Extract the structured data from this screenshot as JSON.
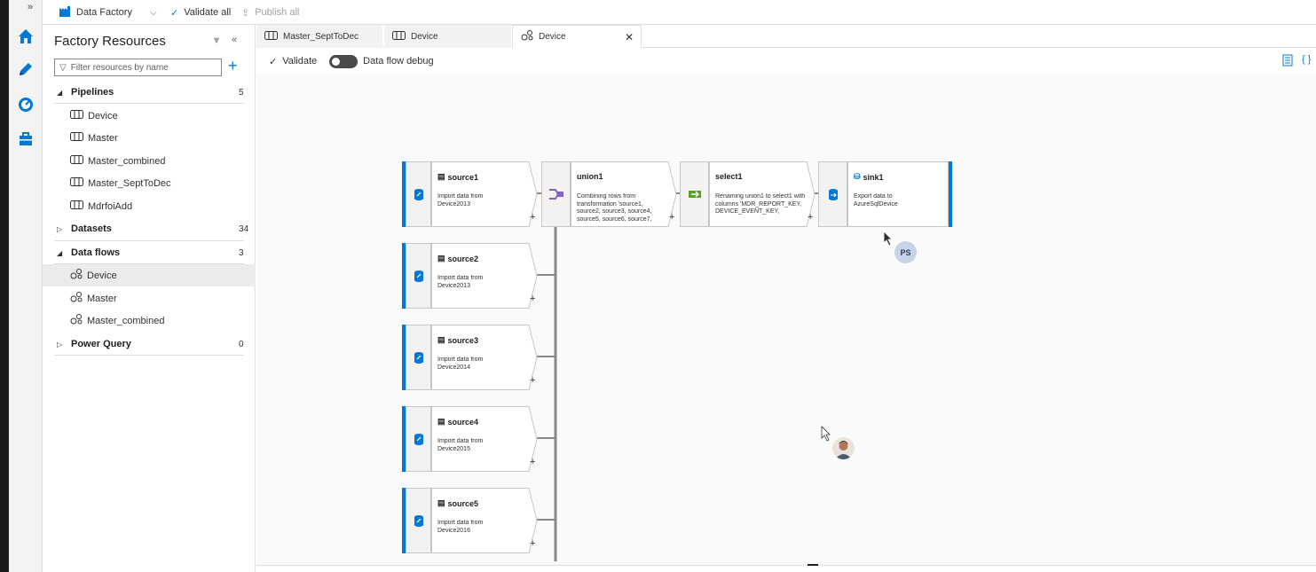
{
  "topbar": {
    "factory_label": "Data Factory",
    "validate_all_label": "Validate all",
    "publish_all_label": "Publish all"
  },
  "panel": {
    "title": "Factory Resources",
    "filter_placeholder": "Filter resources by name",
    "categories": [
      {
        "label": "Pipelines",
        "count": "5",
        "expanded": true,
        "items": [
          "Device",
          "Master",
          "Master_combined",
          "Master_SeptToDec",
          "MdrfoiAdd"
        ]
      },
      {
        "label": "Datasets",
        "count": "34",
        "expanded": false
      },
      {
        "label": "Data flows",
        "count": "3",
        "expanded": true,
        "items": [
          "Device",
          "Master",
          "Master_combined"
        ]
      },
      {
        "label": "Power Query",
        "count": "0",
        "expanded": false
      }
    ]
  },
  "tabs": [
    {
      "label": "Master_SeptToDec",
      "icon": "pipeline-icon"
    },
    {
      "label": "Device",
      "icon": "pipeline-icon"
    },
    {
      "label": "Device",
      "icon": "dataflow-icon",
      "active": true
    }
  ],
  "toolbar": {
    "validate_label": "Validate",
    "debug_label": "Data flow debug",
    "debug_on": false
  },
  "flow": {
    "source1": {
      "title": "source1",
      "desc": "Import data from Device2013"
    },
    "union1": {
      "title": "union1",
      "desc": "Combining rows from transformation 'source1, source2, source3, source4, source5, source6, source7,"
    },
    "select1": {
      "title": "select1",
      "desc": "Renaming union1 to select1 with columns 'MDR_REPORT_KEY, DEVICE_EVENT_KEY,"
    },
    "sink1": {
      "title": "sink1",
      "desc": "Export data to AzureSqlDevice"
    },
    "source2": {
      "title": "source2",
      "desc": "Import data from Device2013"
    },
    "source3": {
      "title": "source3",
      "desc": "Import data from Device2014"
    },
    "source4": {
      "title": "source4",
      "desc": "Import data from Device2015"
    },
    "source5": {
      "title": "source5",
      "desc": "Import data from Device2016"
    },
    "plus": "+"
  },
  "presence": {
    "initials": "PS"
  },
  "colors": {
    "accent": "#0078d4",
    "union": "#8661c5",
    "select": "#5c9e2e"
  }
}
